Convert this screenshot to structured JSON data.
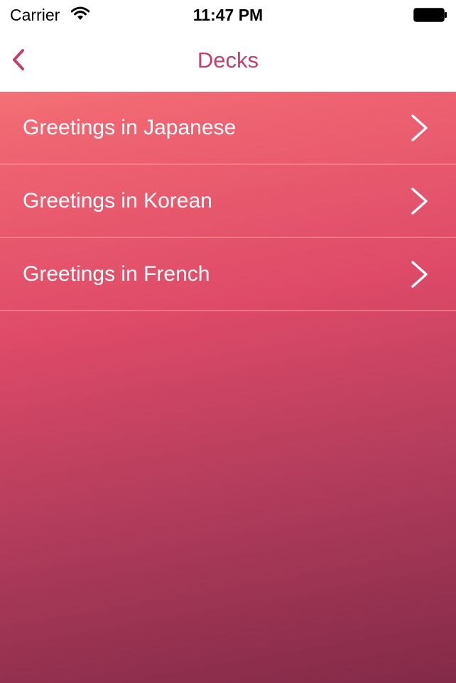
{
  "status_bar": {
    "carrier": "Carrier",
    "time": "11:47 PM",
    "icons": [
      "wifi-icon",
      "battery-icon"
    ]
  },
  "nav_bar": {
    "back_icon": "chevron-left-icon",
    "title": "Decks"
  },
  "decks": [
    {
      "label": "Greetings in Japanese",
      "icon": "chevron-right-icon"
    },
    {
      "label": "Greetings in Korean",
      "icon": "chevron-right-icon"
    },
    {
      "label": "Greetings in French",
      "icon": "chevron-right-icon"
    }
  ],
  "colors": {
    "accent": "#c2416a",
    "gradient_top": "#f98a7c",
    "gradient_bottom": "#822a48",
    "row_text": "#ffffff"
  }
}
